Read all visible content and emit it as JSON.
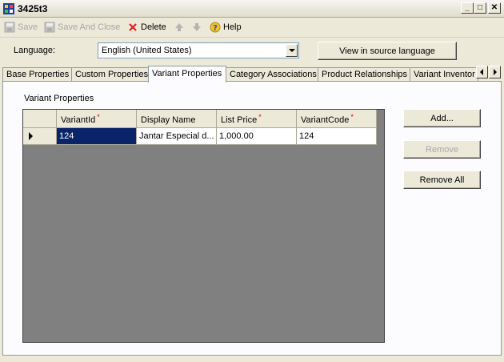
{
  "window": {
    "title": "3425t3"
  },
  "toolbar": {
    "save": "Save",
    "save_and_close": "Save And Close",
    "delete": "Delete",
    "help": "Help"
  },
  "language": {
    "label": "Language:",
    "value": "English (United States)",
    "view_source_button": "View in source language"
  },
  "tabs": [
    "Base Properties",
    "Custom Properties",
    "Variant Properties",
    "Category Associations",
    "Product Relationships",
    "Variant Inventor"
  ],
  "variant_section": {
    "label": "Variant Properties"
  },
  "grid": {
    "columns": [
      "VariantId",
      "Display Name",
      "List Price",
      "VariantCode"
    ],
    "rows": [
      {
        "VariantId": "124",
        "DisplayName": "Jantar Especial d...",
        "ListPrice": "1,000.00",
        "VariantCode": "124"
      }
    ]
  },
  "buttons": {
    "add": "Add...",
    "remove": "Remove",
    "remove_all": "Remove All"
  }
}
